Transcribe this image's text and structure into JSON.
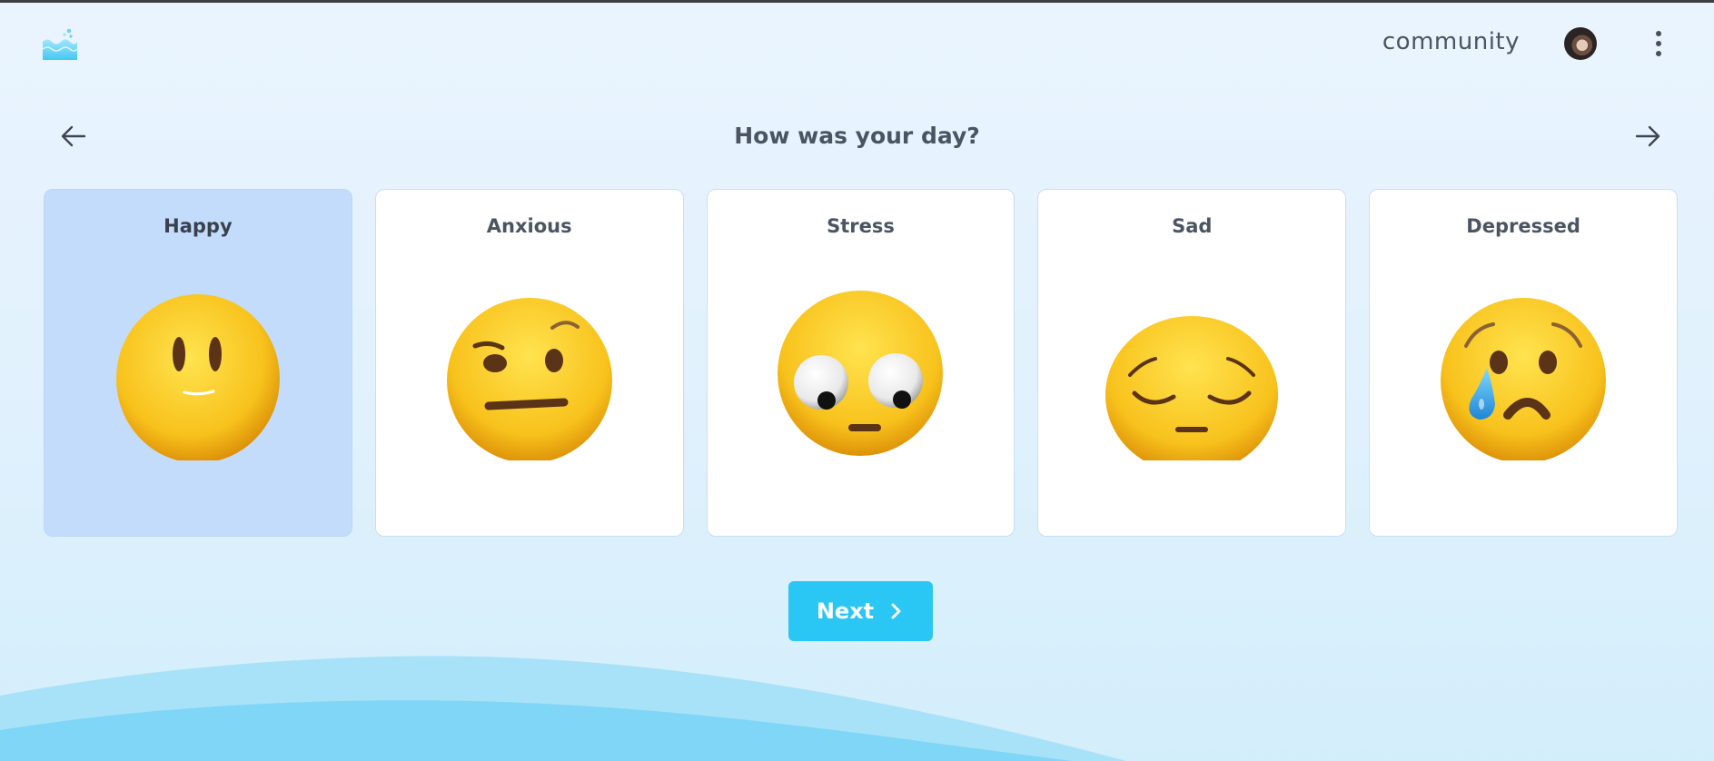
{
  "header": {
    "community_label": "community",
    "logo_icon": "waves-logo-icon",
    "more_icon": "kebab-menu-icon"
  },
  "main": {
    "title": "How was your day?",
    "prev_icon": "arrow-left-icon",
    "next_icon": "arrow-right-icon",
    "selected_mood": "Happy",
    "moods": [
      {
        "label": "Happy",
        "icon": "slightly-smiling-face-icon"
      },
      {
        "label": "Anxious",
        "icon": "face-with-raised-eyebrow-icon"
      },
      {
        "label": "Stress",
        "icon": "face-with-googly-eyes-icon"
      },
      {
        "label": "Sad",
        "icon": "pensive-face-icon"
      },
      {
        "label": "Depressed",
        "icon": "crying-face-icon"
      }
    ]
  },
  "footer": {
    "next_label": "Next"
  },
  "colors": {
    "background": "#eaf4fe",
    "selected_card": "#c3dcfb",
    "accent": "#2ac6f4",
    "wave": "#7fd6f6"
  }
}
